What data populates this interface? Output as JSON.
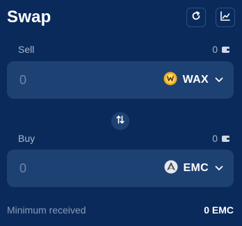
{
  "header": {
    "title": "Swap",
    "refresh_icon": "refresh-icon",
    "chart_icon": "chart-icon"
  },
  "sell": {
    "label": "Sell",
    "balance": "0",
    "amount_placeholder": "0",
    "token": {
      "symbol": "WAX",
      "icon": "wax-token-icon",
      "color": "#f2b01e"
    }
  },
  "buy": {
    "label": "Buy",
    "balance": "0",
    "amount_placeholder": "0",
    "token": {
      "symbol": "EMC",
      "icon": "emc-token-icon",
      "color": "#e5e8ee"
    }
  },
  "summary": {
    "minimum_received_label": "Minimum received",
    "minimum_received_value": "0 EMC"
  },
  "colors": {
    "background": "#0b2a5c",
    "box": "#1e4173",
    "muted_text": "#a8b6cc"
  }
}
